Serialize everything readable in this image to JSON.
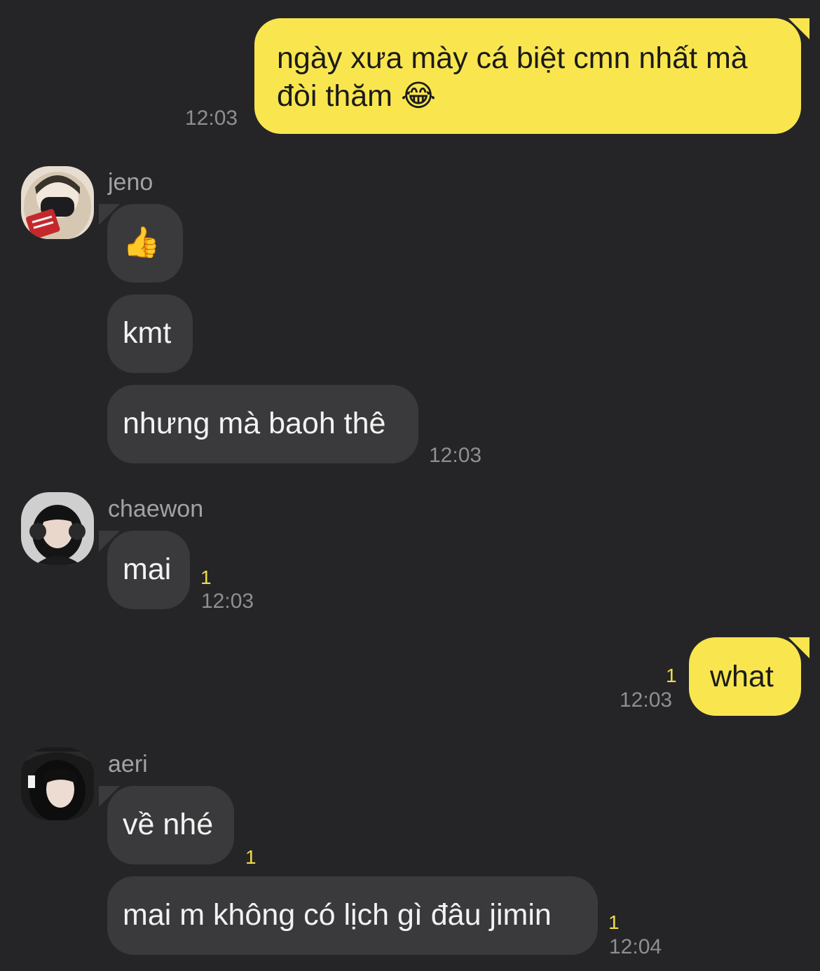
{
  "messages": {
    "m1": {
      "text_line1": "ngày xưa mày cá biệt cmn nhất mà",
      "text_line2": "đòi thăm",
      "emoji": "😂",
      "time": "12:03"
    },
    "m2": {
      "sender": "jeno",
      "emoji": "👍"
    },
    "m3": {
      "text": "kmt"
    },
    "m4": {
      "text": "nhưng mà baoh thê",
      "time": "12:03"
    },
    "m5": {
      "sender": "chaewon",
      "text": "mai",
      "unread": "1",
      "time": "12:03"
    },
    "m6": {
      "text": "what",
      "unread": "1",
      "time": "12:03"
    },
    "m7": {
      "sender": "aeri",
      "text": "về nhé",
      "unread": "1"
    },
    "m8": {
      "text": "mai m không có lịch gì đâu jimin",
      "unread": "1",
      "time": "12:04"
    }
  },
  "colors": {
    "background": "#252527",
    "outgoing_bubble": "#F9E64F",
    "incoming_bubble": "#3A3A3C",
    "timestamp": "#8E8E93",
    "unread_count": "#F2DC48"
  },
  "icons": {
    "jeno_avatar": "avatar-jeno",
    "chaewon_avatar": "avatar-chaewon",
    "aeri_avatar": "avatar-aeri"
  }
}
